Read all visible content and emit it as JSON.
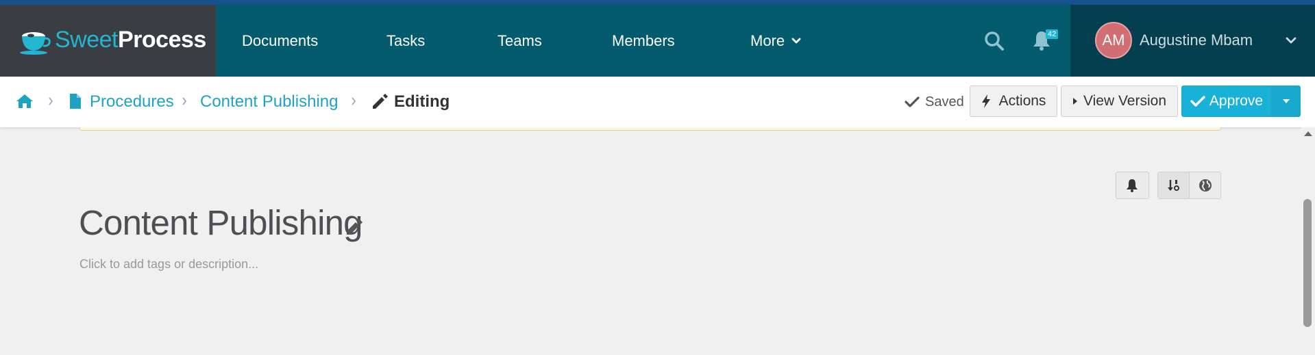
{
  "brand": {
    "sweet": "Sweet",
    "process": "Process"
  },
  "nav": {
    "documents": "Documents",
    "tasks": "Tasks",
    "teams": "Teams",
    "members": "Members",
    "more": "More"
  },
  "notifications": {
    "count": "42"
  },
  "user": {
    "initials": "AM",
    "name": "Augustine Mbam"
  },
  "breadcrumb": {
    "procedures": "Procedures",
    "content_publishing": "Content Publishing",
    "editing": "Editing"
  },
  "status": {
    "saved": "Saved"
  },
  "buttons": {
    "actions": "Actions",
    "view_version": "View Version",
    "approve": "Approve"
  },
  "page": {
    "title": "Content Publishing",
    "description_placeholder": "Click to add tags or description..."
  },
  "colors": {
    "nav_bg": "#045b6e",
    "logo_bg": "#3a3d42",
    "user_bg": "#033f4e",
    "accent": "#1ab1d8",
    "avatar": "#d16e74"
  },
  "icons": [
    "coffee-cup-logo-icon",
    "chevron-down-icon",
    "search-icon",
    "bell-icon",
    "home-icon",
    "file-icon",
    "pencil-icon",
    "check-icon",
    "bolt-icon",
    "caret-right-icon",
    "sort-icon",
    "globe-icon"
  ]
}
